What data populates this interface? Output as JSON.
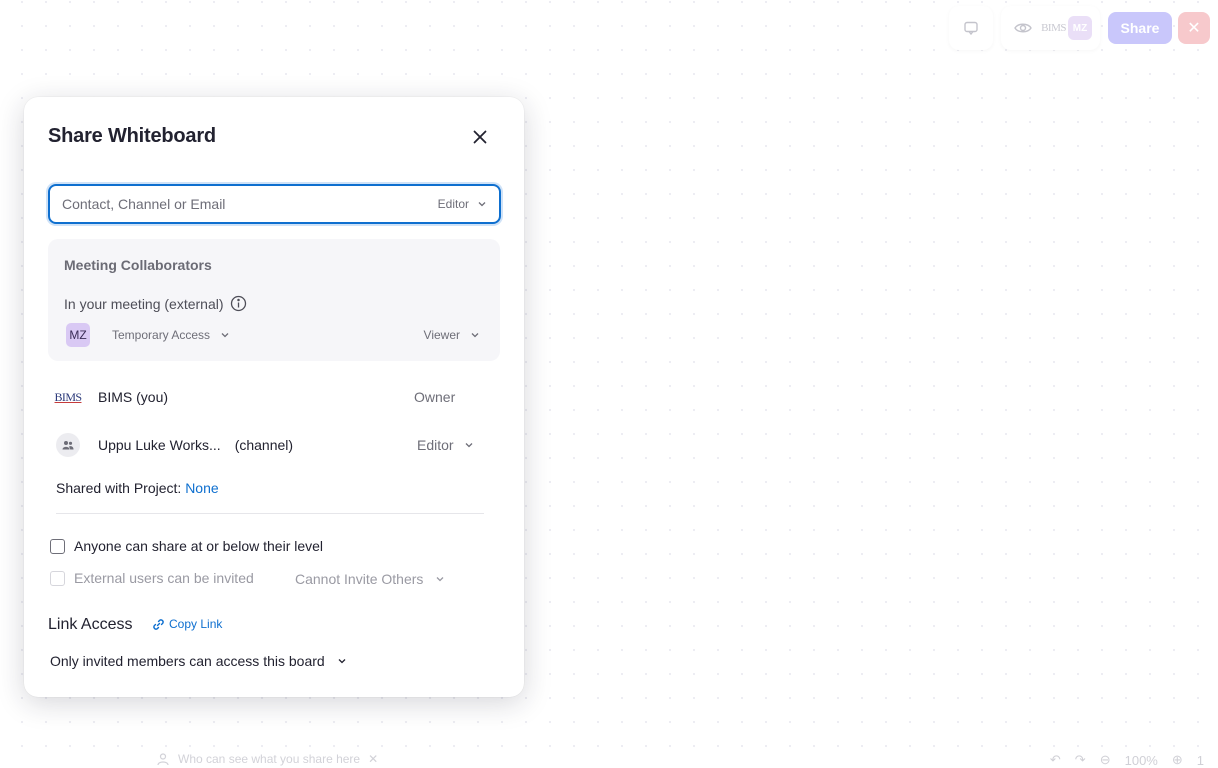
{
  "topbar": {
    "comment_icon": "comment-icon",
    "view_icon": "eye-icon",
    "owner_logo_text": "BIMS",
    "avatar_initials": "MZ",
    "share_label": "Share",
    "close_symbol": "✕",
    "colors": {
      "share_bg": "#c9c7fb",
      "close_bg": "#f7c9cc"
    }
  },
  "dialog": {
    "title": "Share Whiteboard",
    "invite": {
      "placeholder": "Contact, Channel or Email",
      "role": "Editor"
    },
    "meeting": {
      "title": "Meeting Collaborators",
      "subtitle": "In your meeting (external)",
      "participant": {
        "initials": "MZ",
        "access": "Temporary Access",
        "role": "Viewer"
      }
    },
    "members": [
      {
        "name": "BIMS (you)",
        "logo_text": "BIMS",
        "role": "Owner"
      },
      {
        "name": "Uppu Luke Works...",
        "tag": "(channel)",
        "role": "Editor"
      }
    ],
    "project": {
      "label": "Shared with Project:",
      "value": "None"
    },
    "options": {
      "anyone_share": {
        "label": "Anyone can share at or below their level",
        "checked": false
      },
      "external": {
        "label": "External users can be invited",
        "checked": false,
        "select": "Cannot Invite Others"
      }
    },
    "link": {
      "title": "Link Access",
      "copy_label": "Copy Link",
      "access": "Only invited members can access this board"
    }
  },
  "bottom": {
    "hint": "Who can see what you share here",
    "zoom": "100%",
    "page_count": "1"
  },
  "colors": {
    "accent": "#0e6fcf",
    "text": "#222230",
    "muted": "#6e6e78"
  }
}
